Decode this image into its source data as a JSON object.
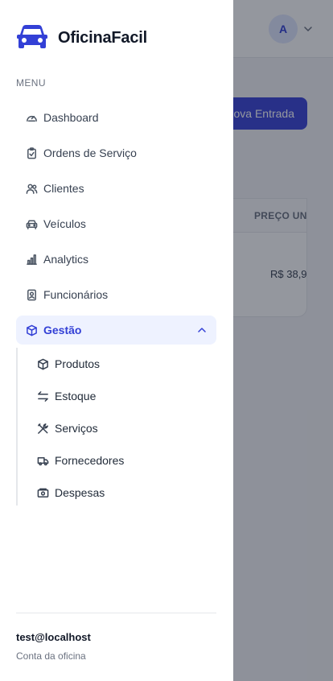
{
  "brand": {
    "name": "OficinaFacil"
  },
  "menu": {
    "label": "MENU",
    "items": [
      {
        "label": "Dashboard",
        "icon": "gauge-icon"
      },
      {
        "label": "Ordens de Serviço",
        "icon": "clipboard-check-icon"
      },
      {
        "label": "Clientes",
        "icon": "users-icon"
      },
      {
        "label": "Veículos",
        "icon": "car-icon"
      },
      {
        "label": "Analytics",
        "icon": "bar-chart-icon"
      },
      {
        "label": "Funcionários",
        "icon": "id-badge-icon"
      },
      {
        "label": "Gestão",
        "icon": "box-icon",
        "expanded": true
      }
    ],
    "submenu": [
      {
        "label": "Produtos",
        "icon": "package-icon"
      },
      {
        "label": "Estoque",
        "icon": "arrows-exchange-icon"
      },
      {
        "label": "Serviços",
        "icon": "tools-icon"
      },
      {
        "label": "Fornecedores",
        "icon": "truck-icon"
      },
      {
        "label": "Despesas",
        "icon": "cash-icon"
      }
    ]
  },
  "user": {
    "email": "test@localhost",
    "subtitle": "Conta da oficina",
    "avatar_initial": "A"
  },
  "background": {
    "new_button_label": "Nova Entrada",
    "table_header": "PREÇO UNI",
    "table_cell": "R$ 38,9"
  },
  "colors": {
    "accent": "#3340d6",
    "active_bg": "#eef2ff",
    "overlay": "rgba(17,24,39,0.45)"
  }
}
